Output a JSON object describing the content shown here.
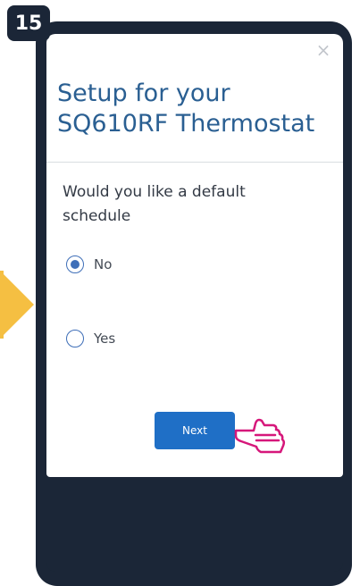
{
  "step": {
    "number": "15"
  },
  "modal": {
    "title_line1": "Setup for your",
    "title_line2": "SQ610RF Thermostat",
    "close_icon": "×",
    "question": "Would you like a default schedule",
    "options": [
      {
        "label": "No",
        "selected": true
      },
      {
        "label": "Yes",
        "selected": false
      }
    ],
    "next_label": "Next"
  },
  "colors": {
    "phone_frame": "#1b2637",
    "title": "#2a5f92",
    "radio": "#3f6fb8",
    "button": "#1f6fc6",
    "arrow": "#f5bf42",
    "hand": "#d6177a"
  }
}
